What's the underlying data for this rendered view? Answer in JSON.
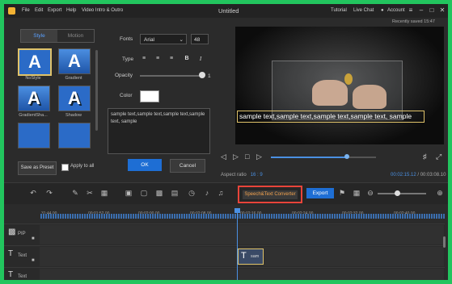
{
  "titlebar": {
    "menus": [
      "File",
      "Edit",
      "Export",
      "Help",
      "Video Intro & Outro"
    ],
    "title": "Untitled",
    "tutorial": "Tutorial",
    "live_chat": "Live Chat",
    "account": "Account"
  },
  "saved_status": "Recently saved 15:47",
  "style_tabs": [
    "Style",
    "Motion"
  ],
  "style_presets": [
    {
      "label": "NoStyle"
    },
    {
      "label": "Gradient"
    },
    {
      "label": "GradientSha..."
    },
    {
      "label": "Shadow"
    }
  ],
  "props": {
    "fonts_label": "Fonts",
    "font_value": "Arial",
    "font_size": "48",
    "type_label": "Type",
    "opacity_label": "Opacity",
    "opacity_value": "1",
    "opacity_level": 1.0,
    "color_label": "Color",
    "text_value": "sample text,sample text,sample text,sample text, sample"
  },
  "buttons": {
    "save_preset": "Save as Preset",
    "apply_all": "Apply to all",
    "ok": "OK",
    "cancel": "Cancel",
    "speech_text": "Speech&Text Converter",
    "export": "Export"
  },
  "preview": {
    "caption": "sample text,sample text,sample text,sample text, sample",
    "aspect_label": "Aspect ratio",
    "aspect_value": "16 : 9",
    "current_time": "00:02:15.12",
    "total_time": "00:03:08.10",
    "progress": 0.72
  },
  "timeline": {
    "ruler": [
      "31:44.00",
      "00:01:52.00",
      "00:02:00.00",
      "00:02:08.00",
      "00:02:16.00",
      "00:02:24.00",
      "00:02:32.00",
      "00:02:40.00"
    ],
    "tracks": [
      {
        "label": "PIP"
      },
      {
        "label": "Text"
      },
      {
        "label": "Text"
      }
    ],
    "clip_label": "sam"
  },
  "colors": {
    "accent": "#1e6ed4",
    "highlight": "#e8443a",
    "speech_text": "#f3a24d"
  }
}
